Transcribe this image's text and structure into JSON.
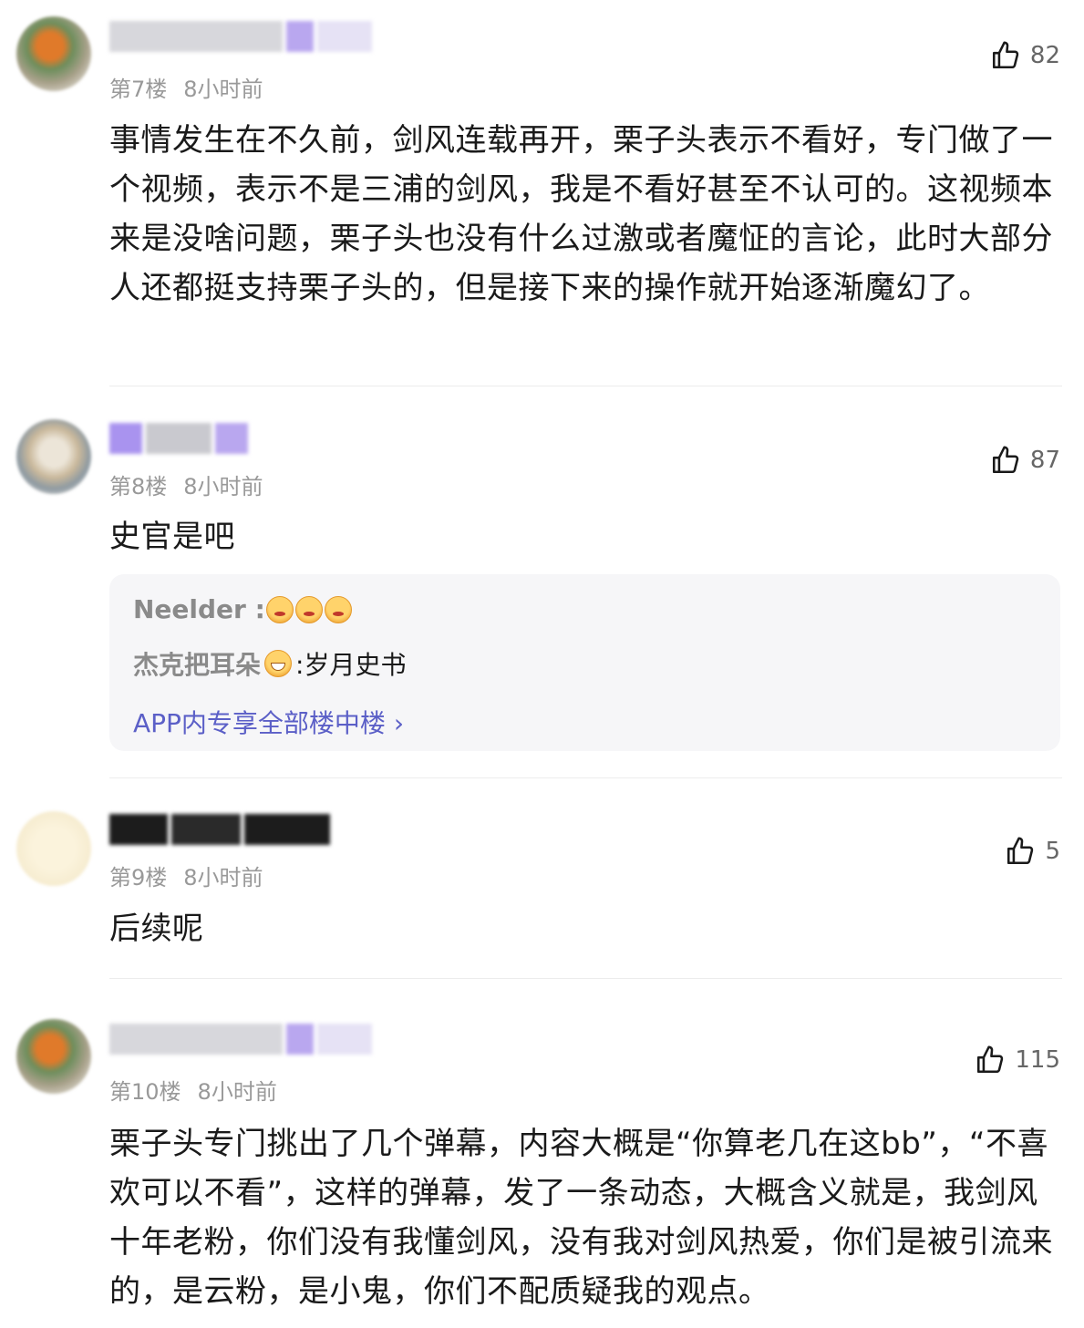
{
  "comments": [
    {
      "floor": "第7楼",
      "time": "8小时前",
      "likes": "82",
      "text": "事情发生在不久前，剑风连载再开，栗子头表示不看好，专门做了一个视频，表示不是三浦的剑风，我是不看好甚至不认可的。这视频本来是没啥问题，栗子头也没有什么过激或者魔怔的言论，此时大部分人还都挺支持栗子头的，但是接下来的操作就开始逐渐魔幻了。"
    },
    {
      "floor": "第8楼",
      "time": "8小时前",
      "likes": "87",
      "text": "史官是吧",
      "replies": [
        {
          "user": "Neelder :",
          "text": ""
        },
        {
          "user": "杰克把耳朵",
          "text": ":岁月史书"
        }
      ],
      "more_link": "APP内专享全部楼中楼 ›"
    },
    {
      "floor": "第9楼",
      "time": "8小时前",
      "likes": "5",
      "text": "后续呢"
    },
    {
      "floor": "第10楼",
      "time": "8小时前",
      "likes": "115",
      "text": "栗子头专门挑出了几个弹幕，内容大概是“你算老几在这bb”，“不喜欢可以不看”，这样的弹幕，发了一条动态，大概含义就是，我剑风十年老粉，你们没有我懂剑风，没有我对剑风热爱，你们是被引流来的，是云粉，是小鬼，你们不配质疑我的观点。"
    }
  ],
  "colors": {
    "text": "#1a1a1a",
    "meta": "#999999",
    "link": "#5b5fc7",
    "reply_bg": "#f6f6f8"
  },
  "icons": {
    "like": "thumbs-up-icon",
    "link_arrow": "chevron-right-icon"
  }
}
